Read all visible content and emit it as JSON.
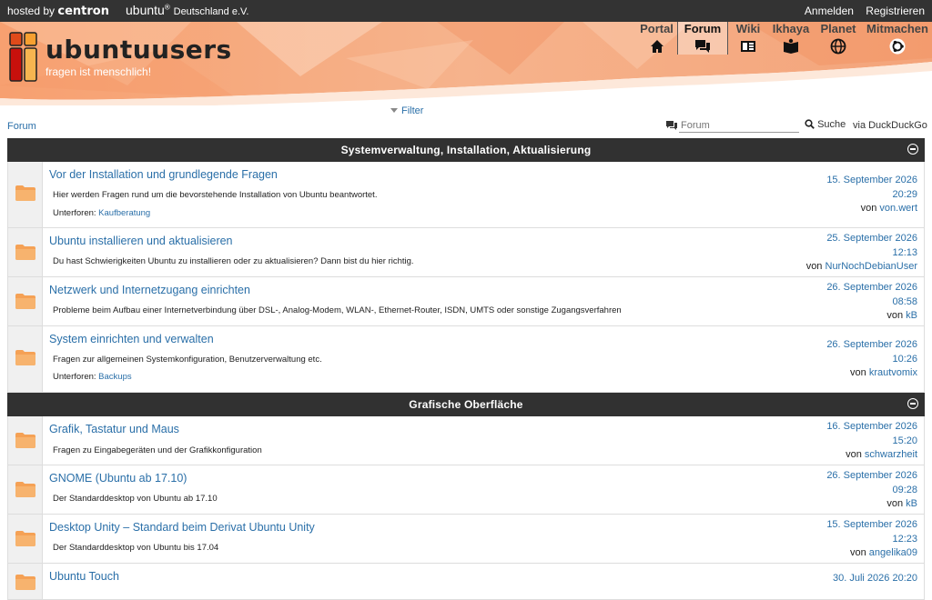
{
  "topbar": {
    "hosted_prefix": "hosted by",
    "hosted_brand": "centron",
    "ubuntu_de": "ubuntu",
    "ubuntu_de_sup": "®",
    "ubuntu_de_suffix": "Deutschland e.V.",
    "login": "Anmelden",
    "register": "Registrieren"
  },
  "header": {
    "brand": "ubuntuusers",
    "slogan": "fragen ist menschlich!",
    "nav": [
      {
        "label": "Portal",
        "icon": "home-icon"
      },
      {
        "label": "Forum",
        "icon": "chat-icon"
      },
      {
        "label": "Wiki",
        "icon": "wiki-icon"
      },
      {
        "label": "Ikhaya",
        "icon": "book-icon"
      },
      {
        "label": "Planet",
        "icon": "globe-icon"
      },
      {
        "label": "Mitmachen",
        "icon": "ubuntu-icon"
      }
    ],
    "active_nav": "Forum",
    "accent_color": "#f28a4f"
  },
  "filter": {
    "label": "Filter"
  },
  "breadcrumb": {
    "label": "Forum"
  },
  "search": {
    "placeholder": "Forum",
    "button": "Suche",
    "via": "via DuckDuckGo"
  },
  "categories": [
    {
      "title": "Systemverwaltung, Installation, Aktualisierung",
      "forums": [
        {
          "title": "Vor der Installation und grundlegende Fragen",
          "description": "Hier werden Fragen rund um die bevorstehende Installation von Ubuntu beantwortet.",
          "subforums_label": "Unterforen:",
          "subforums": "Kaufberatung",
          "date": "15. September 2026",
          "time": "20:29",
          "by_label": "von",
          "user": "von.wert"
        },
        {
          "title": "Ubuntu installieren und aktualisieren",
          "description": "Du hast Schwierigkeiten Ubuntu zu installieren oder zu aktualisieren? Dann bist du hier richtig.",
          "date": "25. September 2026",
          "time": "12:13",
          "by_label": "von",
          "user": "NurNochDebianUser"
        },
        {
          "title": "Netzwerk und Internetzugang einrichten",
          "description": "Probleme beim Aufbau einer Internetverbindung über DSL-, Analog-Modem, WLAN-, Ethernet-Router, ISDN, UMTS oder sonstige Zugangsverfahren",
          "date": "26. September 2026",
          "time": "08:58",
          "by_label": "von",
          "user": "kB"
        },
        {
          "title": "System einrichten und verwalten",
          "description": "Fragen zur allgemeinen Systemkonfiguration, Benutzerverwaltung etc.",
          "subforums_label": "Unterforen:",
          "subforums": "Backups",
          "date": "26. September 2026",
          "time": "10:26",
          "by_label": "von",
          "user": "krautvomix"
        }
      ]
    },
    {
      "title": "Grafische Oberfläche",
      "forums": [
        {
          "title": "Grafik, Tastatur und Maus",
          "description": "Fragen zu Eingabegeräten und der Grafikkonfiguration",
          "date": "16. September 2026",
          "time": "15:20",
          "by_label": "von",
          "user": "schwarzheit"
        },
        {
          "title": "GNOME (Ubuntu ab 17.10)",
          "description": "Der Standarddesktop von Ubuntu ab 17.10",
          "date": "26. September 2026",
          "time": "09:28",
          "by_label": "von",
          "user": "kB"
        },
        {
          "title": "Desktop Unity – Standard beim Derivat Ubuntu Unity",
          "description": "Der Standarddesktop von Ubuntu bis 17.04",
          "date": "15. September 2026",
          "time": "12:23",
          "by_label": "von",
          "user": "angelika09"
        },
        {
          "title": "Ubuntu Touch",
          "date": "30. Juli 2026",
          "time": "20:20"
        }
      ]
    }
  ]
}
